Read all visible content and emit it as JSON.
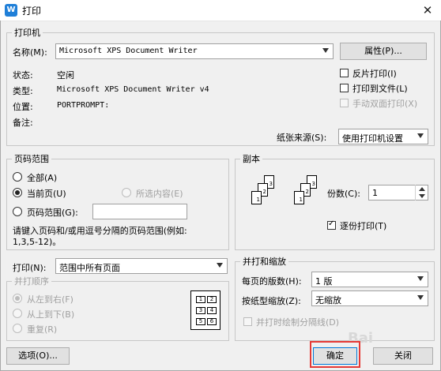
{
  "window": {
    "title": "打印",
    "app_icon_letter": "W"
  },
  "printer": {
    "legend": "打印机",
    "name_label": "名称(M):",
    "name_value": "Microsoft XPS Document Writer",
    "properties_button": "属性(P)...",
    "status_label": "状态:",
    "status_value": "空闲",
    "type_label": "类型:",
    "type_value": "Microsoft XPS Document Writer v4",
    "location_label": "位置:",
    "location_value": "PORTPROMPT:",
    "comment_label": "备注:",
    "reverse_print": "反片打印(I)",
    "print_to_file": "打印到文件(L)",
    "manual_duplex": "手动双面打印(X)",
    "paper_source_label": "纸张来源(S):",
    "paper_source_value": "使用打印机设置"
  },
  "page_range": {
    "legend": "页码范围",
    "all": "全部(A)",
    "current": "当前页(U)",
    "selection": "所选内容(E)",
    "range": "页码范围(G):",
    "hint_line1": "请键入页码和/或用逗号分隔的页码范围(例如:",
    "hint_line2": "1,3,5-12)。"
  },
  "copies": {
    "legend": "副本",
    "count_label": "份数(C):",
    "count_value": "1",
    "collate": "逐份打印(T)",
    "page_numbers": [
      "1",
      "2",
      "3"
    ]
  },
  "print_what": {
    "label": "打印(N):",
    "value": "范围中所有页面"
  },
  "order": {
    "legend": "并打顺序",
    "left_right": "从左到右(F)",
    "top_bottom": "从上到下(B)",
    "repeat": "重复(R)",
    "cells": [
      "1",
      "2",
      "3",
      "4",
      "5",
      "6"
    ]
  },
  "zoom": {
    "legend": "并打和缩放",
    "pages_per_sheet_label": "每页的版数(H):",
    "pages_per_sheet_value": "1 版",
    "scale_label": "按纸型缩放(Z):",
    "scale_value": "无缩放",
    "draw_borders": "并打时绘制分隔线(D)"
  },
  "footer": {
    "options_button": "选项(O)...",
    "ok_button": "确定",
    "close_button": "关闭"
  },
  "watermark": "Bai"
}
